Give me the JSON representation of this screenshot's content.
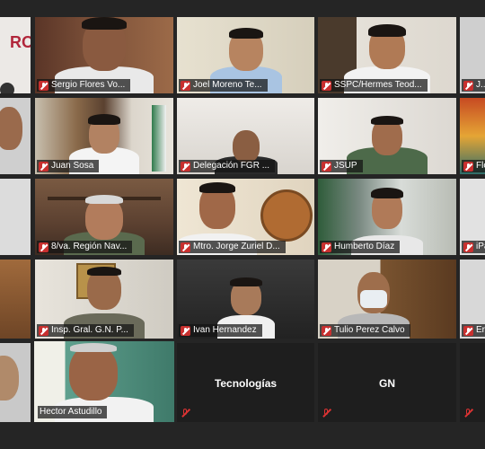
{
  "tiles": {
    "r1c1": {
      "name": ""
    },
    "r1c2": {
      "name": "Sergio Flores Vo..."
    },
    "r1c3": {
      "name": "Joel Moreno Te..."
    },
    "r1c4": {
      "name": "SSPC/Hermes Teod..."
    },
    "r1c5": {
      "name": "J..."
    },
    "r2c2": {
      "name": "Juan Sosa"
    },
    "r2c3": {
      "name": "Delegación FGR ..."
    },
    "r2c4": {
      "name": "JSUP"
    },
    "r2c5": {
      "name": "Flore..."
    },
    "r3c2": {
      "name": "8/va. Región Nav..."
    },
    "r3c3": {
      "name": "Mtro. Jorge Zuriel D..."
    },
    "r3c4": {
      "name": "Humberto Díaz"
    },
    "r3c5": {
      "name": "iPad ..."
    },
    "r4c2": {
      "name": "Insp. Gral. G.N. P..."
    },
    "r4c3": {
      "name": "Ivan Hernandez"
    },
    "r4c4": {
      "name": "Tulio Perez Calvo"
    },
    "r4c5": {
      "name": "Er..."
    },
    "r5c2": {
      "name": "Hector Astudillo"
    },
    "r5c3": {
      "label": "Tecnologías"
    },
    "r5c4": {
      "label": "GN"
    }
  },
  "logo_text": "RO",
  "colors": {
    "active_speaker": "#c9dd52",
    "mute": "#c8302f",
    "background": "#252525"
  }
}
